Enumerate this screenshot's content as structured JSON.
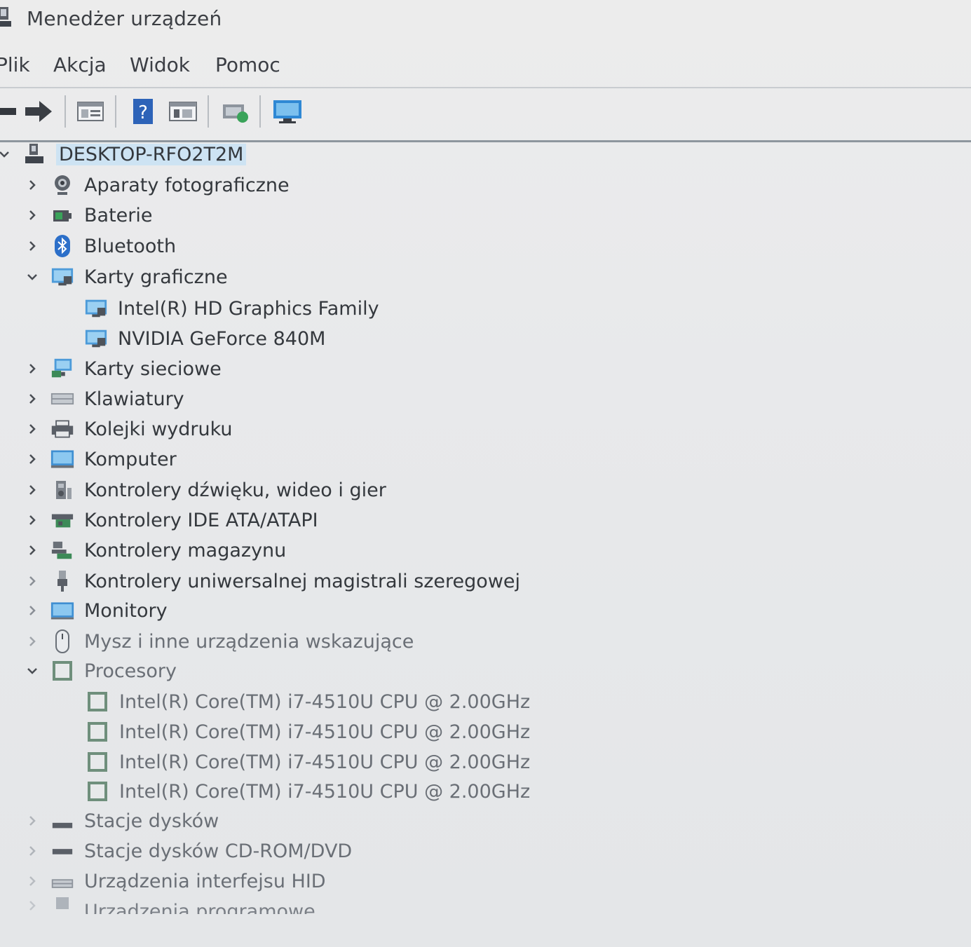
{
  "window": {
    "title": "Menedżer urządzeń"
  },
  "menu": {
    "items": [
      "Plik",
      "Akcja",
      "Widok",
      "Pomoc"
    ]
  },
  "toolbar": {
    "buttons": [
      "back-arrow-icon",
      "forward-arrow-icon",
      "properties-icon",
      "help-icon",
      "view-icon",
      "scan-hardware-icon",
      "monitor-icon"
    ]
  },
  "tree": {
    "root": "DESKTOP-RFO2T2M",
    "items": [
      {
        "label": "Aparaty fotograficzne",
        "icon": "camera-icon",
        "expanded": false
      },
      {
        "label": "Baterie",
        "icon": "battery-icon",
        "expanded": false
      },
      {
        "label": "Bluetooth",
        "icon": "bluetooth-icon",
        "expanded": false
      },
      {
        "label": "Karty graficzne",
        "icon": "display-adapter-icon",
        "expanded": true,
        "children": [
          "Intel(R) HD Graphics Family",
          "NVIDIA GeForce 840M"
        ]
      },
      {
        "label": "Karty sieciowe",
        "icon": "network-adapter-icon",
        "expanded": false
      },
      {
        "label": "Klawiatury",
        "icon": "keyboard-icon",
        "expanded": false
      },
      {
        "label": "Kolejki wydruku",
        "icon": "printer-icon",
        "expanded": false
      },
      {
        "label": "Komputer",
        "icon": "computer-icon",
        "expanded": false
      },
      {
        "label": "Kontrolery dźwięku, wideo i gier",
        "icon": "speaker-icon",
        "expanded": false
      },
      {
        "label": "Kontrolery IDE ATA/ATAPI",
        "icon": "ide-controller-icon",
        "expanded": false
      },
      {
        "label": "Kontrolery magazynu",
        "icon": "storage-controller-icon",
        "expanded": false
      },
      {
        "label": "Kontrolery uniwersalnej magistrali szeregowej",
        "icon": "usb-icon",
        "expanded": false
      },
      {
        "label": "Monitory",
        "icon": "monitor-icon",
        "expanded": false
      },
      {
        "label": "Mysz i inne urządzenia wskazujące",
        "icon": "mouse-icon",
        "expanded": false
      },
      {
        "label": "Procesory",
        "icon": "processor-icon",
        "expanded": true,
        "children": [
          "Intel(R) Core(TM) i7-4510U CPU @ 2.00GHz",
          "Intel(R) Core(TM) i7-4510U CPU @ 2.00GHz",
          "Intel(R) Core(TM) i7-4510U CPU @ 2.00GHz",
          "Intel(R) Core(TM) i7-4510U CPU @ 2.00GHz"
        ]
      },
      {
        "label": "Stacje dysków",
        "icon": "disk-drive-icon",
        "expanded": false
      },
      {
        "label": "Stacje dysków CD-ROM/DVD",
        "icon": "dvd-drive-icon",
        "expanded": false
      },
      {
        "label": "Urządzenia interfejsu HID",
        "icon": "hid-icon",
        "expanded": false
      },
      {
        "label": "Urządzenia programowe",
        "icon": "software-device-icon",
        "expanded": false
      }
    ]
  },
  "colors": {
    "selection": "#cde3f3",
    "text": "#34383d",
    "accent_blue": "#2f7fd0"
  }
}
